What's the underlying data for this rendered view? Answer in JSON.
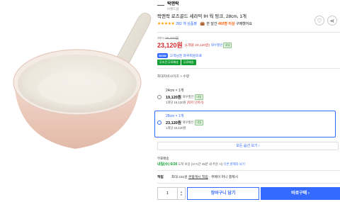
{
  "brand": {
    "name": "락앤락",
    "sub": "브랜드샵"
  },
  "product": {
    "title": "락앤락 로즈골드 세라믹 IH 웍 핑크, 28cm, 1개",
    "stars": "★★★★★",
    "review_count": "282 개 상품평",
    "buy_text": "한 달간",
    "buy_count": "400명 이상",
    "buy_suffix": "구매했어요"
  },
  "price": {
    "discount": "36%",
    "original": "36,400원",
    "current": "23,120원",
    "unit": "(1개당 23,120원)",
    "coupang_tag": "와우할인",
    "check_badge": "내일"
  },
  "wow": {
    "badge": "WOW",
    "text": "고객님은 와우회원으로"
  },
  "shipping_badges": [
    "무조건 무료배송",
    "무료배송"
  ],
  "option_path": "최대지비사이즈 > 수량",
  "options": [
    {
      "size": "24cm × 1개",
      "price": "19,120원",
      "tag": "와우할인",
      "badge": "내일",
      "unit": "1개당 19,120원",
      "note": "(최저 단위가)"
    },
    {
      "size": "28cm × 1개",
      "price": "23,120원",
      "tag": "와우할인",
      "badge": "내일",
      "unit": "1개당 23,120원",
      "note": ""
    }
  ],
  "more_options": "모든 옵션 보기 ›",
  "delivery": {
    "label": "무료배송",
    "date": "내일(수) 6/26",
    "note": "도착 보장 (17시간 45분 내 주문 시)",
    "link": "다른 판매자 보기"
  },
  "points": {
    "label": "적립",
    "text_prefix": "최대 231원",
    "link": "쿠팡캐시 적립",
    "text_suffix": "· 쿠페이 머니 결제시"
  },
  "purchase": {
    "quantity": "1",
    "cart_label": "장바구니 담기",
    "buy_label": "바로구매 ›"
  },
  "colors": {
    "accent": "#346aff",
    "price_red": "#d42f2f",
    "green": "#15a035",
    "star": "#f5a000",
    "pan_body": "#eed4c8"
  }
}
